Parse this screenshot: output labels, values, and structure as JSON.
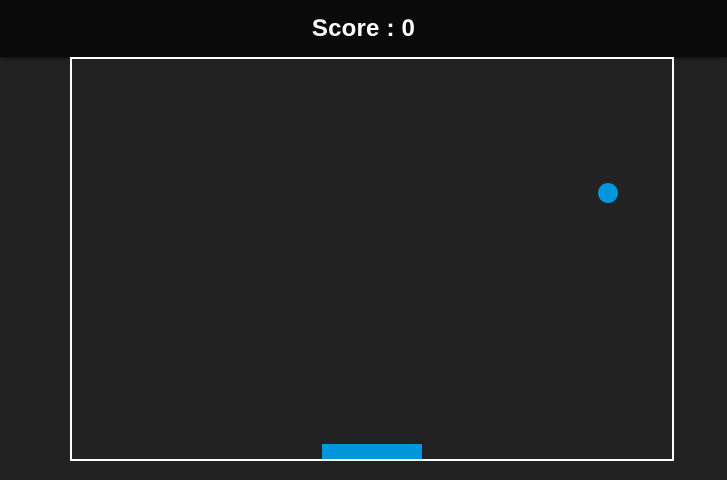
{
  "header": {
    "score_label": "Score",
    "score_separator": ":",
    "score_value": "0"
  },
  "game": {
    "ball_color": "#0096dc",
    "paddle_color": "#0096dc",
    "border_color": "#ffffff",
    "background_color": "#222222"
  }
}
